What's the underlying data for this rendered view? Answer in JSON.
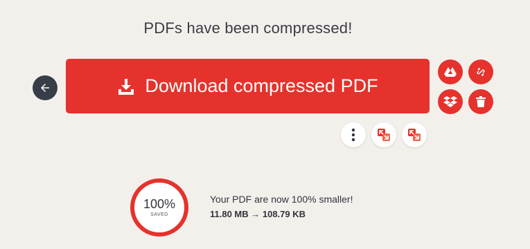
{
  "header": {
    "title": "PDFs have been compressed!"
  },
  "actions": {
    "download_label": "Download compressed PDF"
  },
  "result": {
    "percent": "100%",
    "saved_label": "SAVED",
    "message": "Your PDF are now 100% smaller!",
    "sizes": "11.80 MB → 108.79 KB"
  },
  "colors": {
    "accent": "#e5322d",
    "background": "#f3f0ec",
    "back_button": "#383e48"
  },
  "icons": {
    "back": "arrow-left-icon",
    "download": "download-icon",
    "drive": "google-drive-icon",
    "link": "link-icon",
    "dropbox": "dropbox-icon",
    "delete": "trash-icon",
    "more": "more-vertical-icon",
    "compress": "compress-icon",
    "expand": "expand-icon"
  }
}
